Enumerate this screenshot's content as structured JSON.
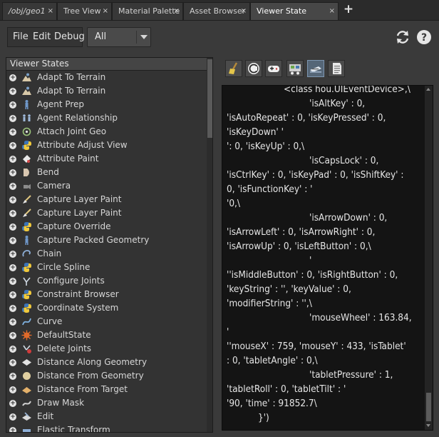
{
  "tabs": [
    {
      "label": "/obj/geo1",
      "closable": true
    },
    {
      "label": "Tree View",
      "closable": true
    },
    {
      "label": "Material Palette",
      "closable": true
    },
    {
      "label": "Asset Browser",
      "closable": true
    },
    {
      "label": "Viewer State Browser",
      "closable": true,
      "active": true
    }
  ],
  "tab_close_glyph": "×",
  "add_tab_glyph": "+",
  "menus": {
    "file": "File",
    "edit": "Edit",
    "debug": "Debug"
  },
  "filter": {
    "value": "All"
  },
  "list": {
    "header": "Viewer States",
    "items": [
      {
        "label": "Adapt To Terrain",
        "icon": "terrain-icon"
      },
      {
        "label": "Adapt To Terrain",
        "icon": "terrain-icon"
      },
      {
        "label": "Agent Prep",
        "icon": "agent-icon"
      },
      {
        "label": "Agent Relationship",
        "icon": "agent-relationship-icon"
      },
      {
        "label": "Attach Joint Geo",
        "icon": "joint-geo-icon"
      },
      {
        "label": "Attribute Adjust View",
        "icon": "python-icon"
      },
      {
        "label": "Attribute Paint",
        "icon": "attribute-paint-icon"
      },
      {
        "label": "Bend",
        "icon": "bend-icon"
      },
      {
        "label": "Camera",
        "icon": "camera-icon"
      },
      {
        "label": "Capture Layer Paint",
        "icon": "brush-icon"
      },
      {
        "label": "Capture Layer Paint",
        "icon": "brush-icon"
      },
      {
        "label": "Capture Override",
        "icon": "python-icon"
      },
      {
        "label": "Capture Packed Geometry",
        "icon": "agent-icon"
      },
      {
        "label": "Chain",
        "icon": "chain-icon"
      },
      {
        "label": "Circle Spline",
        "icon": "python-icon"
      },
      {
        "label": "Configure Joints",
        "icon": "joints-icon"
      },
      {
        "label": "Constraint Browser",
        "icon": "python-icon"
      },
      {
        "label": "Coordinate System",
        "icon": "python-icon"
      },
      {
        "label": "Curve",
        "icon": "curve-icon"
      },
      {
        "label": "DefaultState",
        "icon": "default-state-icon"
      },
      {
        "label": "Delete Joints",
        "icon": "delete-joints-icon"
      },
      {
        "label": "Distance Along Geometry",
        "icon": "distance-along-icon"
      },
      {
        "label": "Distance From Geometry",
        "icon": "distance-from-icon"
      },
      {
        "label": "Distance From Target",
        "icon": "distance-target-icon"
      },
      {
        "label": "Draw Mask",
        "icon": "draw-mask-icon"
      },
      {
        "label": "Edit",
        "icon": "edit-icon"
      },
      {
        "label": "Elastic Transform",
        "icon": "elastic-icon"
      }
    ]
  },
  "code_lines": [
    {
      "text": "<class hou.UIEventDevice>,\\",
      "indent": 80
    },
    {
      "text": "'isAltKey' : 0,",
      "indent": 116
    },
    {
      "text": "'isAutoRepeat' : 0, 'isKeyPressed' : 0,",
      "indent": 0
    },
    {
      "text": "'isKeyDown' '",
      "indent": 0
    },
    {
      "text": "': 0, 'isKeyUp' : 0,\\",
      "indent": 0
    },
    {
      "text": "'isCapsLock' : 0,",
      "indent": 116
    },
    {
      "text": "'isCtrlKey' : 0, 'isKeyPad' : 0, 'isShiftKey' :",
      "indent": 0
    },
    {
      "text": "0, 'isFunctionKey' : '",
      "indent": 0
    },
    {
      "text": "'0,\\",
      "indent": 0
    },
    {
      "text": "'isArrowDown' : 0,",
      "indent": 116
    },
    {
      "text": "'isArrowLeft' : 0, 'isArrowRight' : 0,",
      "indent": 0
    },
    {
      "text": "'isArrowUp' : 0, 'isLeftButton' : 0,\\",
      "indent": 0
    },
    {
      "text": "'",
      "indent": 116
    },
    {
      "text": "''isMiddleButton' : 0, 'isRightButton' : 0,",
      "indent": 0
    },
    {
      "text": "'keyString' : '', 'keyValue' : 0,",
      "indent": 0
    },
    {
      "text": "'modifierString' : '',\\",
      "indent": 0
    },
    {
      "text": "'mouseWheel' : 163.84,",
      "indent": 116
    },
    {
      "text": "'",
      "indent": 0
    },
    {
      "text": "''mouseX' : 759, 'mouseY' : 433, 'isTablet'",
      "indent": 0
    },
    {
      "text": ": 0, 'tabletAngle' : 0,\\",
      "indent": 0
    },
    {
      "text": "'tabletPressure' : 1,",
      "indent": 116
    },
    {
      "text": "'tabletRoll' : 0, 'tabletTilt' : '",
      "indent": 0
    },
    {
      "text": "'90, 'time' : 91852.7\\",
      "indent": 0
    },
    {
      "text": "}')",
      "indent": 44
    }
  ],
  "colors": {
    "accent": "#6f8aa6",
    "python_blue": "#3b74b8",
    "python_yellow": "#f0c93c",
    "background": "#3a3a3a",
    "code_bg": "#141414"
  }
}
